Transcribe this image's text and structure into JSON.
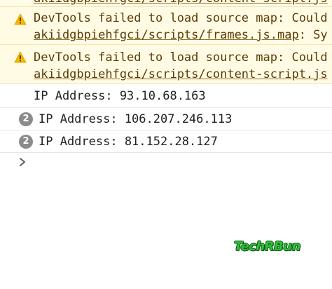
{
  "console": {
    "clipped_top": {
      "link": "akiidgbpiehfgci/scripts/content-script.js"
    },
    "warnings": [
      {
        "icon": "warning-triangle-icon",
        "message": "DevTools failed to load source map: Could",
        "link": "akiidgbpiehfgci/scripts/frames.js.map",
        "link_suffix": ": Sy"
      },
      {
        "icon": "warning-triangle-icon",
        "message": "DevTools failed to load source map: Could",
        "link": "akiidgbpiehfgci/scripts/content-script.js"
      }
    ],
    "logs": [
      {
        "count": "",
        "text": "IP Address: 93.10.68.163"
      },
      {
        "count": "2",
        "text": "IP Address: 106.207.246.113"
      },
      {
        "count": "2",
        "text": "IP Address: 81.152.28.127"
      }
    ],
    "prompt_icon": "chevron-right-icon"
  },
  "watermark": "TechRBun",
  "colors": {
    "warning_background": "#fffbe5",
    "warning_text": "#5c3c00",
    "warning_icon": "#f2b800",
    "badge": "#8b8b8b",
    "watermark": "#2fbf3a"
  }
}
